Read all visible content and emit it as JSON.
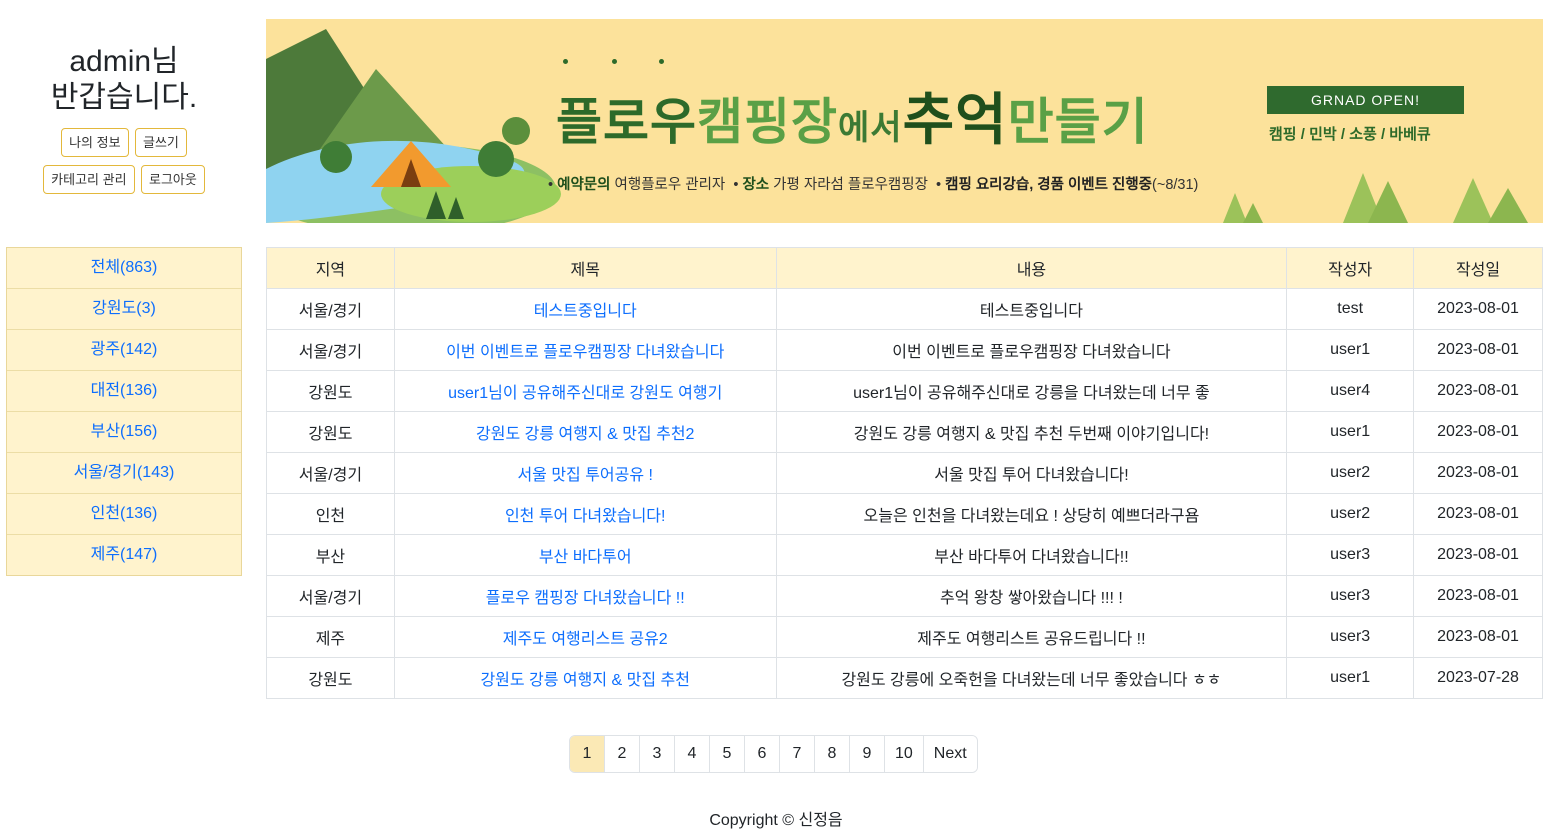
{
  "user": {
    "greeting_line1": "admin님",
    "greeting_line2": "반갑습니다.",
    "buttons": [
      "나의 정보",
      "글쓰기",
      "카테고리 관리",
      "로그아웃"
    ]
  },
  "categories": [
    "전체(863)",
    "강원도(3)",
    "광주(142)",
    "대전(136)",
    "부산(156)",
    "서울/경기(143)",
    "인천(136)",
    "제주(147)"
  ],
  "banner": {
    "title_part1": "플로우",
    "title_part2": "캠핑장",
    "title_part3": "에서",
    "title_part4": "추억",
    "title_part5": "만들기",
    "info1_label": "예약문의",
    "info1_text": "여행플로우 관리자",
    "info2_label": "장소",
    "info2_text": "가평 자라섬 플로우캠핑장",
    "info3_label": "캠핑 요리강습, 경품 이벤트 진행중",
    "info3_text": "(~8/31)",
    "grand_open": "GRNAD OPEN!",
    "services": "캠핑 / 민박 / 소풍 / 바베큐"
  },
  "table": {
    "headers": [
      "지역",
      "제목",
      "내용",
      "작성자",
      "작성일"
    ],
    "rows": [
      {
        "region": "서울/경기",
        "title": "테스트중입니다",
        "content": "테스트중입니다",
        "author": "test",
        "date": "2023-08-01"
      },
      {
        "region": "서울/경기",
        "title": "이번 이벤트로 플로우캠핑장 다녀왔습니다",
        "content": "이번 이벤트로 플로우캠핑장 다녀왔습니다",
        "author": "user1",
        "date": "2023-08-01"
      },
      {
        "region": "강원도",
        "title": "user1님이 공유해주신대로 강원도 여행기",
        "content": "user1님이 공유해주신대로 강릉을 다녀왔는데 너무 좋",
        "author": "user4",
        "date": "2023-08-01"
      },
      {
        "region": "강원도",
        "title": "강원도 강릉 여행지 & 맛집 추천2",
        "content": "강원도 강릉 여행지 & 맛집 추천 두번째 이야기입니다!",
        "author": "user1",
        "date": "2023-08-01"
      },
      {
        "region": "서울/경기",
        "title": "서울 맛집 투어공유 !",
        "content": "서울 맛집 투어 다녀왔습니다!",
        "author": "user2",
        "date": "2023-08-01"
      },
      {
        "region": "인천",
        "title": "인천 투어 다녀왔습니다!",
        "content": "오늘은 인천을 다녀왔는데요 ! 상당히 예쁘더라구욤",
        "author": "user2",
        "date": "2023-08-01"
      },
      {
        "region": "부산",
        "title": "부산 바다투어",
        "content": "부산 바다투어 다녀왔습니다!!",
        "author": "user3",
        "date": "2023-08-01"
      },
      {
        "region": "서울/경기",
        "title": "플로우 캠핑장 다녀왔습니다 !!",
        "content": "추억 왕창 쌓아왔습니다 !!! !",
        "author": "user3",
        "date": "2023-08-01"
      },
      {
        "region": "제주",
        "title": "제주도 여행리스트 공유2",
        "content": "제주도 여행리스트 공유드립니다 !!",
        "author": "user3",
        "date": "2023-08-01"
      },
      {
        "region": "강원도",
        "title": "강원도 강릉 여행지 & 맛집 추천",
        "content": "강원도 강릉에 오죽헌을 다녀왔는데 너무 좋았습니다 ㅎㅎ",
        "author": "user1",
        "date": "2023-07-28"
      }
    ]
  },
  "pagination": {
    "pages": [
      "1",
      "2",
      "3",
      "4",
      "5",
      "6",
      "7",
      "8",
      "9",
      "10"
    ],
    "active": "1",
    "next_label": "Next"
  },
  "footer": "Copyright © 신정음",
  "colors": {
    "accent_link": "#0d6efd",
    "category_bg": "#fff3cd",
    "banner_bg": "#fce29b",
    "banner_green": "#2f6a2e",
    "button_border": "#e3b83b"
  }
}
